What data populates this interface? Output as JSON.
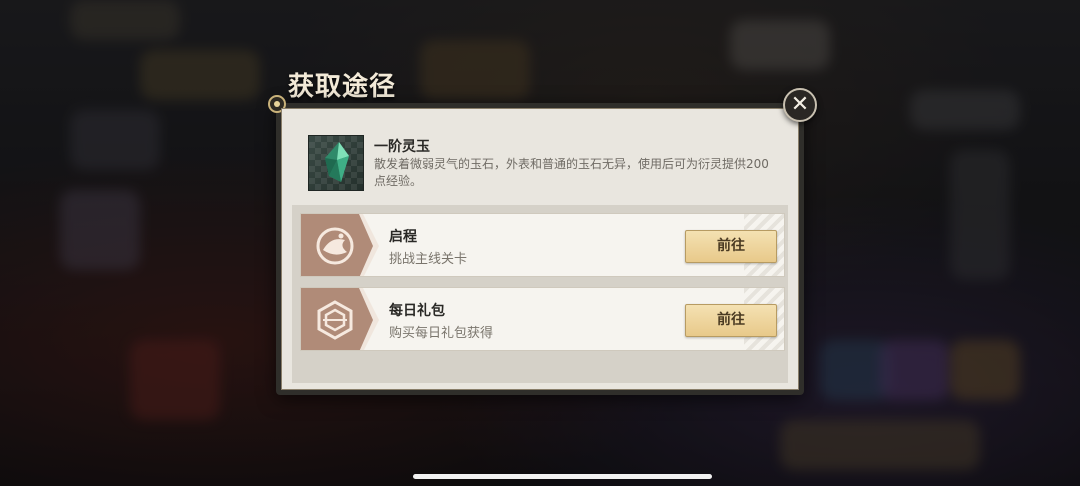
{
  "dialog": {
    "title": "获取途径"
  },
  "item": {
    "name": "一阶灵玉",
    "description": "散发着微弱灵气的玉石，外表和普通的玉石无异，使用后可为衍灵提供200点经验。",
    "icon": "green-jade-crystal-icon"
  },
  "sources": [
    {
      "title": "启程",
      "subtitle": "挑战主线关卡",
      "button_label": "前往",
      "icon": "journey-emblem-icon"
    },
    {
      "title": "每日礼包",
      "subtitle": "购买每日礼包获得",
      "button_label": "前往",
      "icon": "gift-pack-emblem-icon"
    }
  ],
  "colors": {
    "panel_bg": "#e9e6df",
    "button_gold": "#e8c98a",
    "hex_emblem": "#b08b78"
  }
}
